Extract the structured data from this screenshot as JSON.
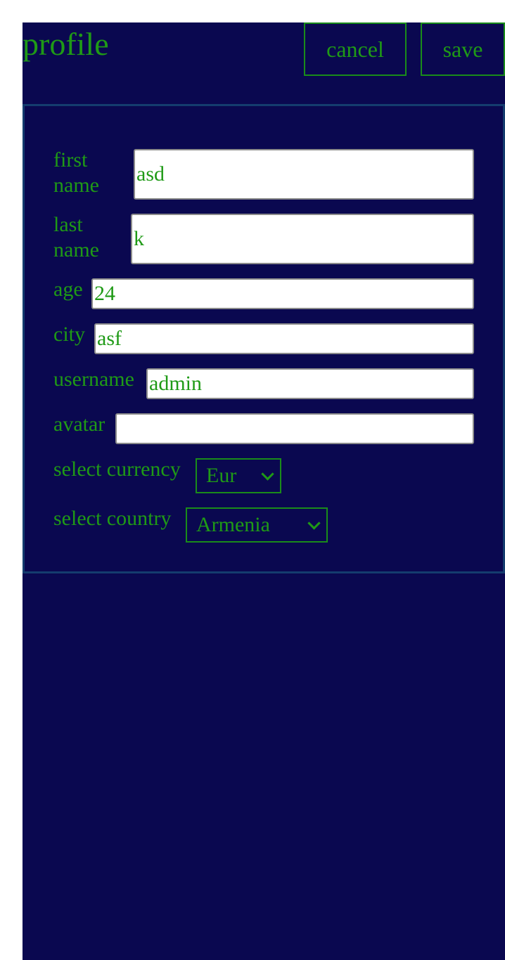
{
  "header": {
    "title": "profile",
    "cancel_label": "cancel",
    "save_label": "save"
  },
  "form": {
    "first_name": {
      "label": "first name",
      "value": "asd"
    },
    "last_name": {
      "label": "last name",
      "value": "k"
    },
    "age": {
      "label": "age",
      "value": "24"
    },
    "city": {
      "label": "city",
      "value": "asf"
    },
    "username": {
      "label": "username",
      "value": "admin"
    },
    "avatar": {
      "label": "avatar",
      "value": ""
    },
    "currency": {
      "label": "select currency",
      "selected": "Eur"
    },
    "country": {
      "label": "select country",
      "selected": "Armenia"
    }
  },
  "icons": {
    "dropdown": "chevron-down-icon"
  },
  "colors": {
    "background": "#0a0850",
    "accent_text": "#1f9a16",
    "panel_border": "#143c6e",
    "input_background": "#ffffff"
  }
}
